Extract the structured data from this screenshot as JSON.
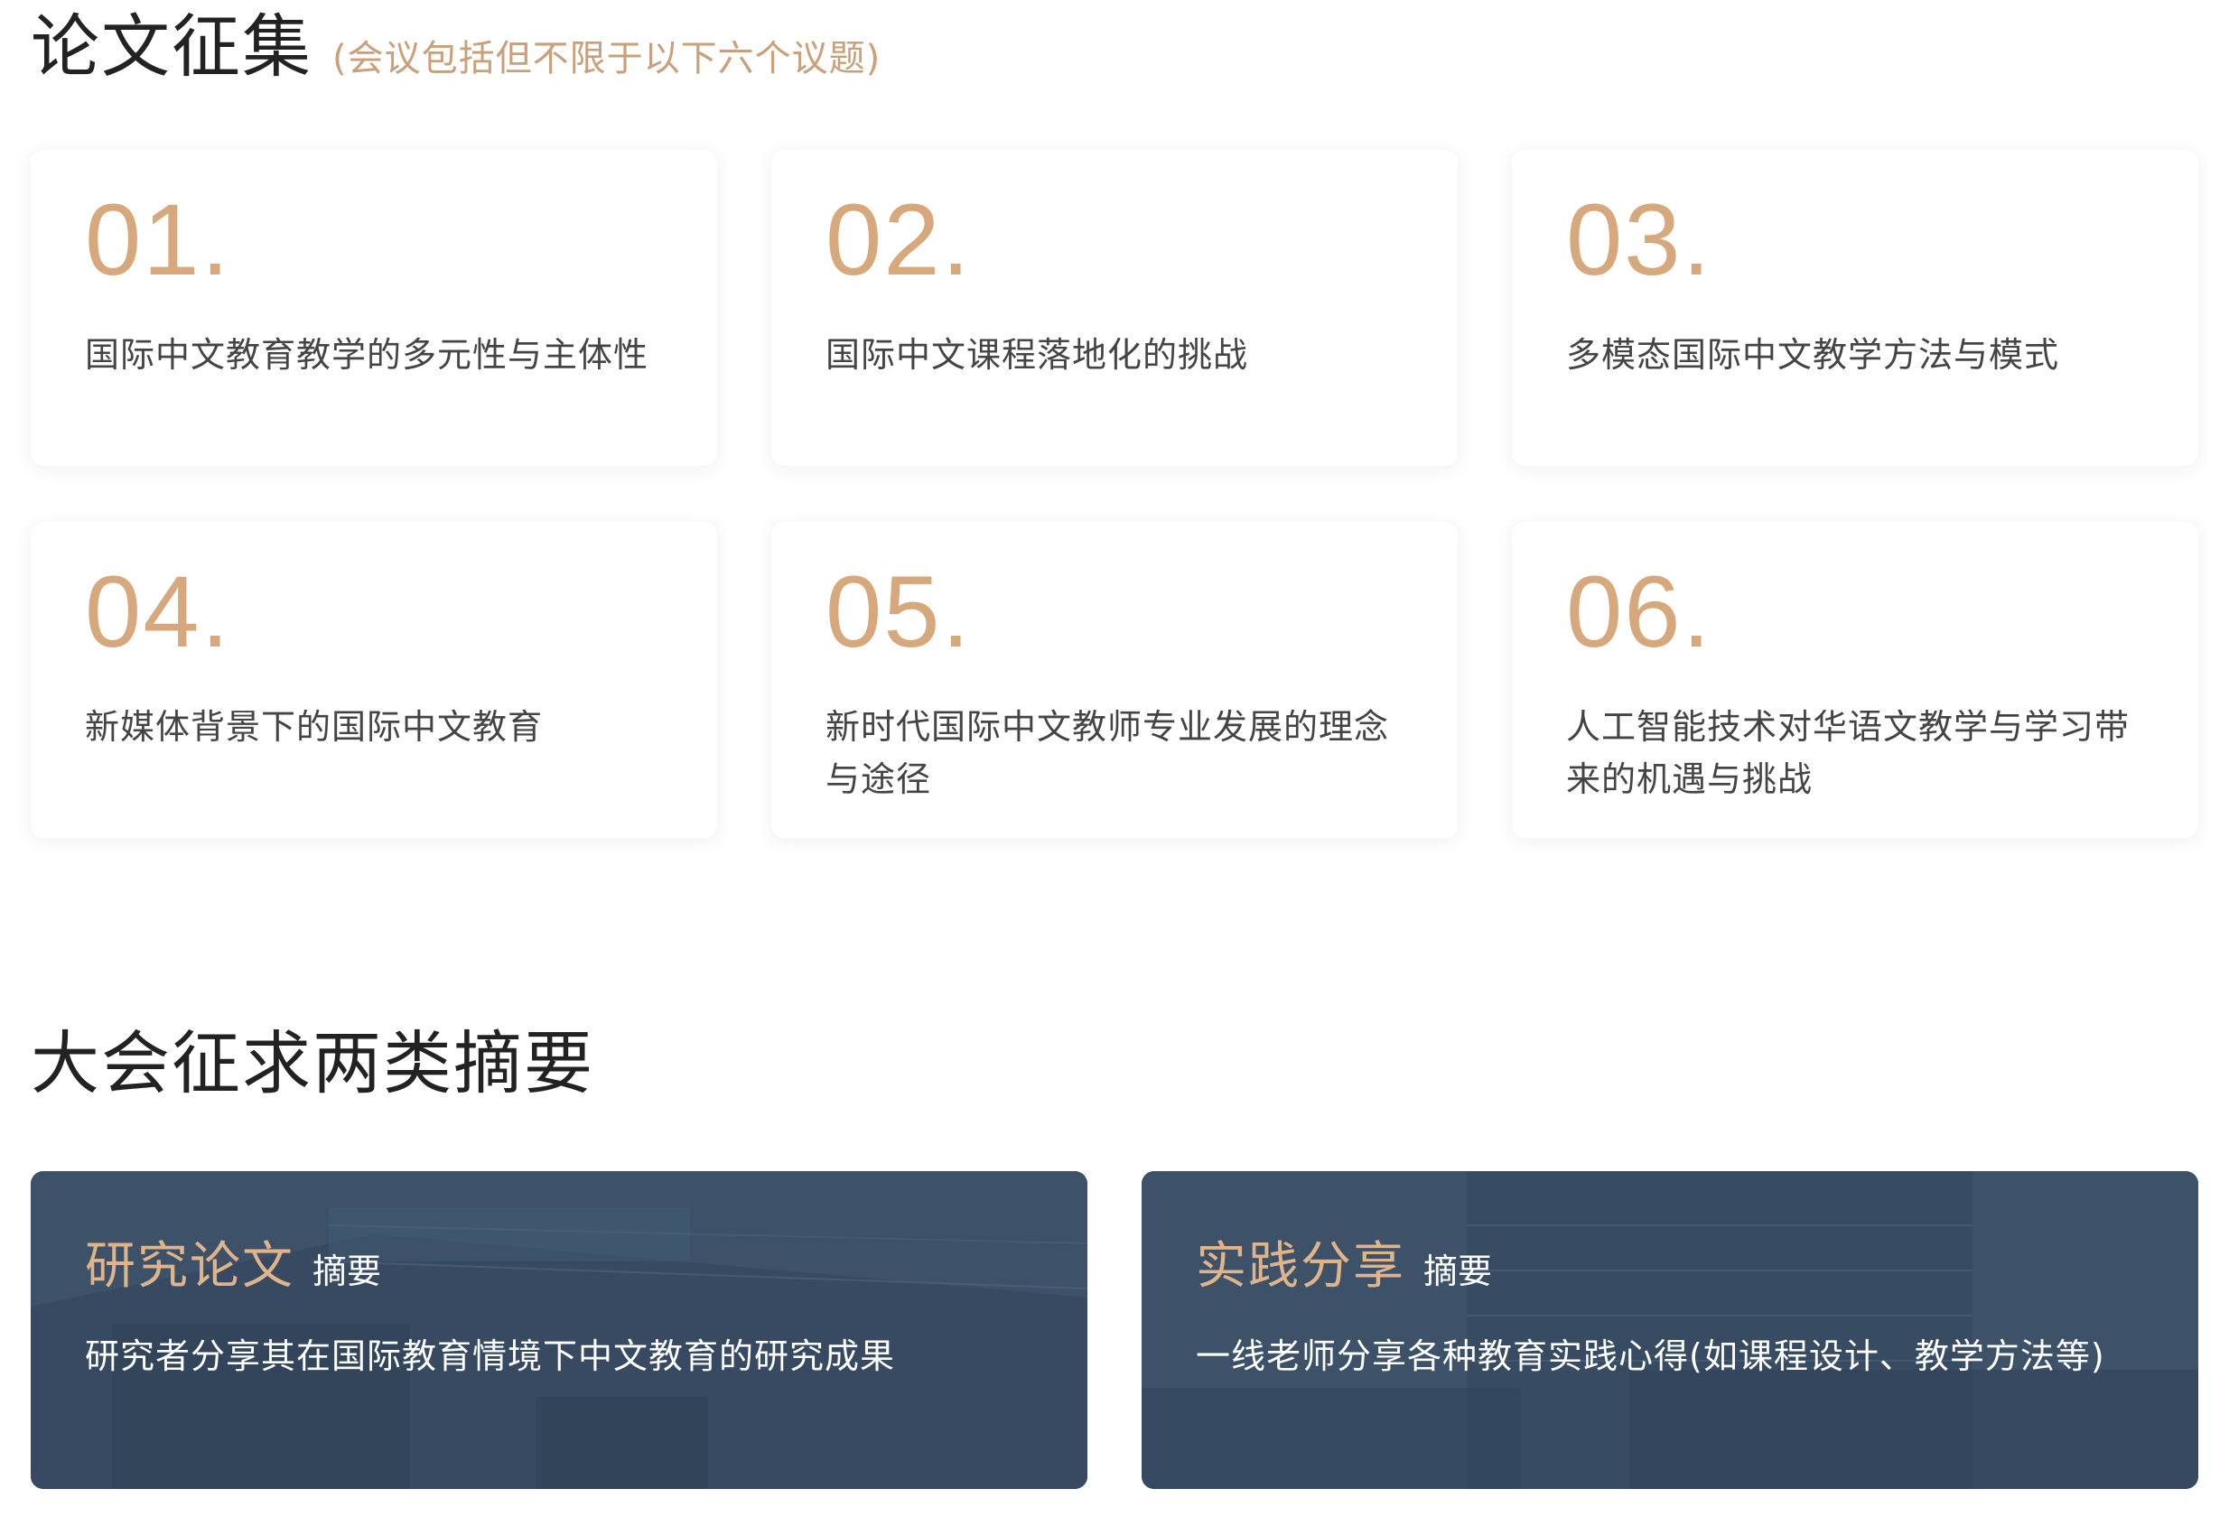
{
  "topics_section": {
    "title": "论文征集",
    "subtitle": "(会议包括但不限于以下六个议题)",
    "items": [
      {
        "number": "01.",
        "text": "国际中文教育教学的多元性与主体性"
      },
      {
        "number": "02.",
        "text": "国际中文课程落地化的挑战"
      },
      {
        "number": "03.",
        "text": "多模态国际中文教学方法与模式"
      },
      {
        "number": "04.",
        "text": "新媒体背景下的国际中文教育"
      },
      {
        "number": "05.",
        "text": "新时代国际中文教师专业发展的理念与途径"
      },
      {
        "number": "06.",
        "text": "人工智能技术对华语文教学与学习带来的机遇与挑战"
      }
    ]
  },
  "abstracts_section": {
    "title": "大会征求两类摘要",
    "cards": [
      {
        "title": "研究论文",
        "tag": "摘要",
        "description": "研究者分享其在国际教育情境下中文教育的研究成果"
      },
      {
        "title": "实践分享",
        "tag": "摘要",
        "description": "一线老师分享各种教育实践心得(如课程设计、教学方法等)"
      }
    ]
  },
  "colors": {
    "accent": "#d6a87c",
    "subtitle": "#c9a07a",
    "card_overlay": "#3c5068",
    "heading": "#222222",
    "body_text": "#444444"
  }
}
